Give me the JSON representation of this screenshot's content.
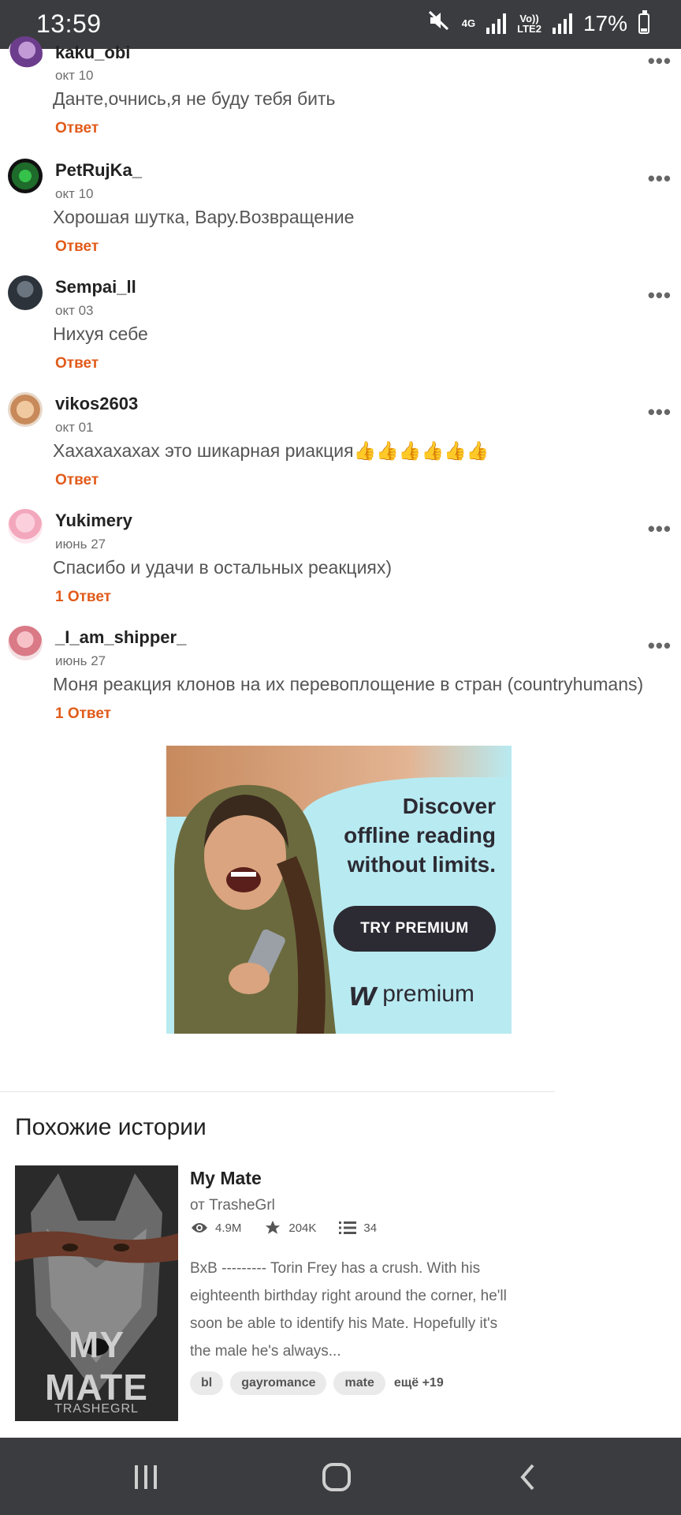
{
  "status_bar": {
    "time": "13:59",
    "net_4g": "4G",
    "volte": "Vo))",
    "lte2": "LTE2",
    "battery": "17%",
    "icons": [
      "mute-icon",
      "signal-icon",
      "battery-icon"
    ]
  },
  "comments": [
    {
      "user": "kaku_obi",
      "date": "окт 10",
      "text": "Данте,очнись,я не буду тебя бить",
      "reply": "Ответ"
    },
    {
      "user": "PetRujKa_",
      "date": "окт 10",
      "text": "Хорошая шутка,  Вару.Возвращение",
      "reply": "Ответ"
    },
    {
      "user": "Sempai_ll",
      "date": "окт 03",
      "text": "Нихуя себе",
      "reply": "Ответ"
    },
    {
      "user": "vikos2603",
      "date": "окт 01",
      "text": "Хахахахахах это шикарная риакция👍👍👍👍👍👍",
      "reply": "Ответ"
    },
    {
      "user": "Yukimery",
      "date": "июнь 27",
      "text": "Спасибо и удачи в остальных реакциях)",
      "reply": "1 Ответ"
    },
    {
      "user": "_I_am_shipper_",
      "date": "июнь 27",
      "text": "Моня реакция клонов на их перевоплощение в стран (countryhumans)",
      "reply": "1 Ответ"
    }
  ],
  "more_label": "•••",
  "ad": {
    "headline_1": "Discover",
    "headline_2": "offline reading",
    "headline_3": "without limits.",
    "button": "TRY PREMIUM",
    "brand_w": "w",
    "brand": "premium"
  },
  "similar": {
    "title": "Похожие истории",
    "story": {
      "cover_title": "MY MATE",
      "cover_author": "TRASHEGRL",
      "title": "My Mate",
      "author": "от TrasheGrl",
      "views": "4.9M",
      "votes": "204K",
      "parts": "34",
      "description": "BxB --------- Torin Frey has a crush. With his eighteenth birthday right around the corner, he'll soon be able to identify his Mate. Hopefully it's the male he's always...",
      "tags": [
        "bl",
        "gayromance",
        "mate"
      ],
      "more_tags": "ещё +19"
    }
  },
  "nav": {
    "icons": [
      "recents-icon",
      "home-icon",
      "back-icon"
    ]
  }
}
